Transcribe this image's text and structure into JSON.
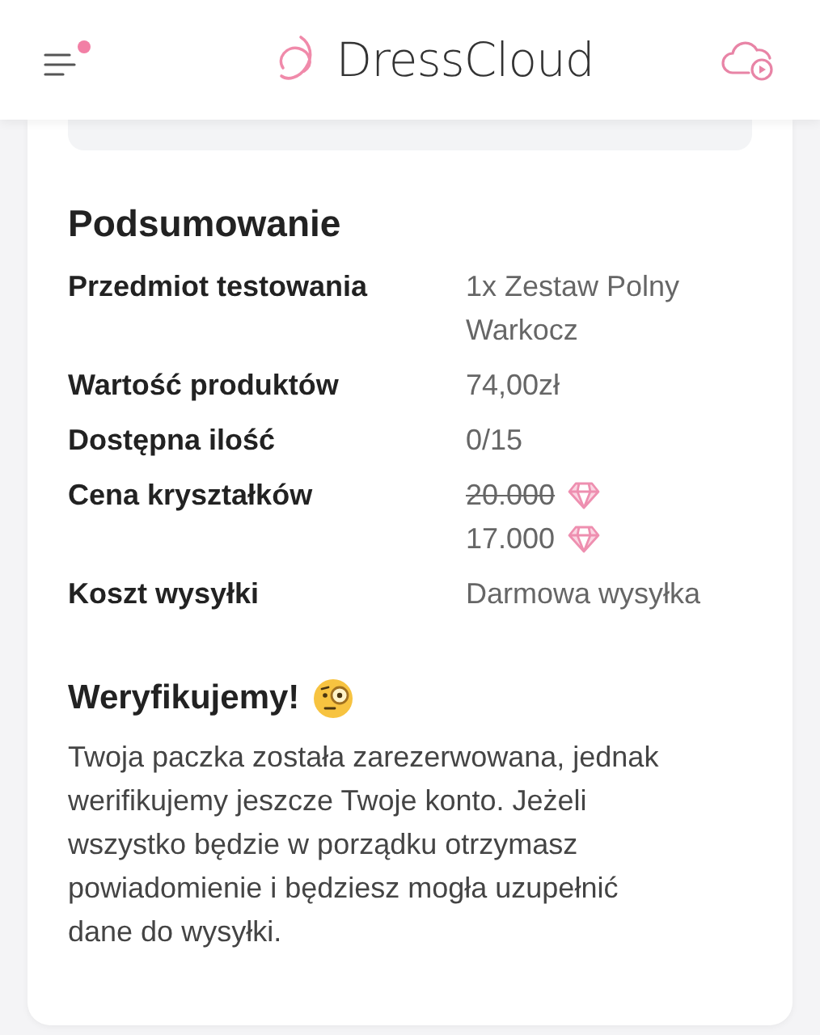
{
  "header": {
    "logo_text": "DressCloud",
    "menu_notification": true
  },
  "summary": {
    "title": "Podsumowanie",
    "rows": [
      {
        "kind": "text",
        "label": "Przedmiot testowania",
        "value": "1x Zestaw Polny Warkocz"
      },
      {
        "kind": "text",
        "label": "Wartość produktów",
        "value": "74,00zł"
      },
      {
        "kind": "text",
        "label": "Dostępna ilość",
        "value": "0/15"
      },
      {
        "kind": "crystals",
        "label": "Cena kryształków",
        "prices": [
          {
            "amount": "20.000",
            "struck": true
          },
          {
            "amount": "17.000",
            "struck": false
          }
        ]
      },
      {
        "kind": "text",
        "label": "Koszt wysyłki",
        "value": "Darmowa wysyłka"
      }
    ]
  },
  "notice": {
    "title": "Weryfikujemy!",
    "text": "Twoja paczka została zarezerwowana, jednak werifikujemy jeszcze Twoje konto. Jeżeli wszystko będzie w porządku otrzymasz powiadomienie i będziesz mogła uzupełnić dane do wysyłki."
  }
}
